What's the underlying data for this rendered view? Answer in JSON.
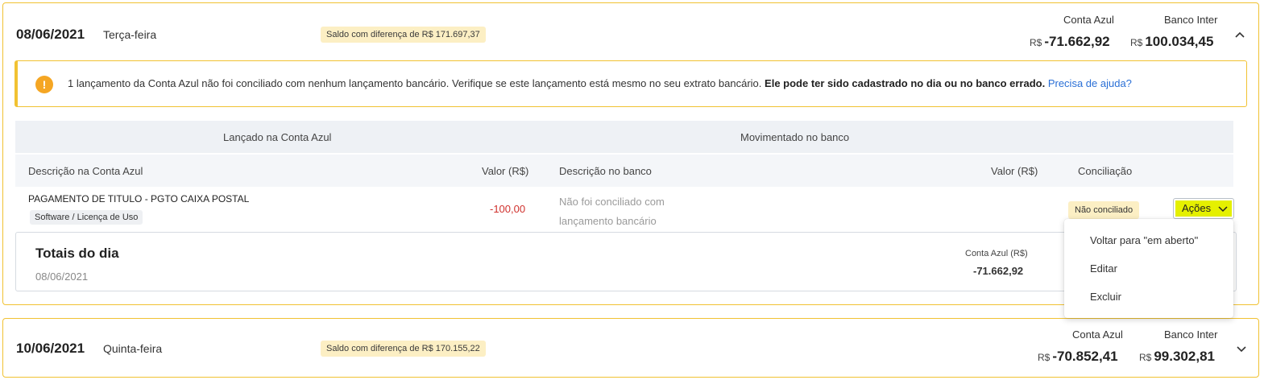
{
  "days": [
    {
      "date": "08/06/2021",
      "weekday": "Terça-feira",
      "diff_badge": "Saldo com diferença de R$ 171.697,37",
      "conta_azul_label": "Conta Azul",
      "banco_label": "Banco Inter",
      "currency": "R$",
      "conta_azul_value": "-71.662,92",
      "banco_value": "100.034,45"
    },
    {
      "date": "10/06/2021",
      "weekday": "Quinta-feira",
      "diff_badge": "Saldo com diferença de R$ 170.155,22",
      "conta_azul_label": "Conta Azul",
      "banco_label": "Banco Inter",
      "currency": "R$",
      "conta_azul_value": "-70.852,41",
      "banco_value": "99.302,81"
    }
  ],
  "alert": {
    "icon": "warning-icon",
    "text": "1 lançamento da Conta Azul não foi conciliado com nenhum lançamento bancário. Verifique se este lançamento está mesmo no seu extrato bancário.",
    "bold": "Ele pode ter sido cadastrado no dia ou no banco errado.",
    "link": "Precisa de ajuda?"
  },
  "table": {
    "group_headers": [
      "Lançado na Conta Azul",
      "Movimentado no banco"
    ],
    "columns": [
      "Descrição na Conta Azul",
      "Valor (R$)",
      "Descrição no banco",
      "Valor (R$)",
      "Conciliação"
    ],
    "rows": [
      {
        "description": "PAGAMENTO DE TITULO - PGTO CAIXA POSTAL",
        "category": "Software / Licença de Uso",
        "value": "-100,00",
        "bank_description": "Não foi conciliado com lançamento bancário",
        "status": "Não conciliado",
        "actions_label": "Ações"
      }
    ]
  },
  "totals": {
    "title": "Totais do dia",
    "date": "08/06/2021",
    "conta_azul_label": "Conta Azul (R$)",
    "conta_azul_value": "-71.662,92"
  },
  "actions_menu": [
    "Voltar para \"em aberto\"",
    "Editar",
    "Excluir"
  ],
  "colors": {
    "card_border": "#f1c232",
    "badge_bg": "#fcefc4",
    "negative": "#d0312d",
    "link": "#2a6fd6",
    "actions_bg": "#e5f000",
    "warning": "#f5a623"
  }
}
